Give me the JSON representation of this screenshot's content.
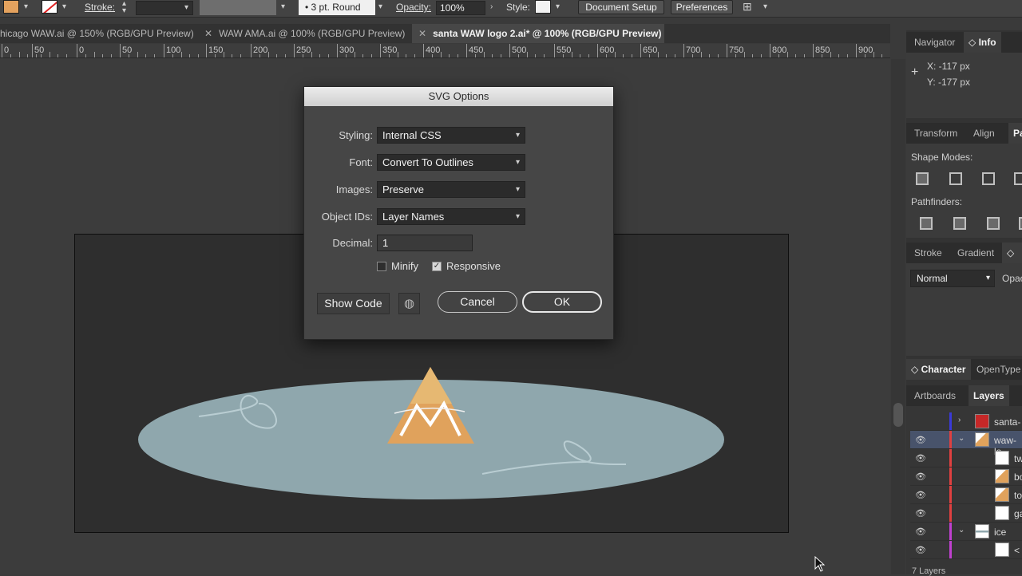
{
  "control_bar": {
    "fill_color": "#e4a25e",
    "stroke_label": "Stroke:",
    "brush_label": "3 pt. Round",
    "opacity_label": "Opacity:",
    "opacity_value": "100%",
    "style_label": "Style:",
    "document_setup": "Document Setup",
    "preferences": "Preferences"
  },
  "tabs": [
    {
      "label": "hicago WAW.ai @ 150% (RGB/GPU Preview)"
    },
    {
      "label": "WAW AMA.ai @ 100% (RGB/GPU Preview)"
    },
    {
      "label": "santa WAW logo 2.ai* @ 100% (RGB/GPU Preview)"
    }
  ],
  "ruler": [
    "0",
    "50",
    "0",
    "50",
    "100",
    "150",
    "200",
    "250",
    "300",
    "350",
    "400",
    "450",
    "500",
    "550",
    "600",
    "650",
    "700",
    "750",
    "800",
    "850",
    "900"
  ],
  "dialog": {
    "title": "SVG Options",
    "styling_label": "Styling:",
    "styling_value": "Internal CSS",
    "font_label": "Font:",
    "font_value": "Convert To Outlines",
    "images_label": "Images:",
    "images_value": "Preserve",
    "objectids_label": "Object IDs:",
    "objectids_value": "Layer Names",
    "decimal_label": "Decimal:",
    "decimal_value": "1",
    "minify_label": "Minify",
    "minify_checked": false,
    "responsive_label": "Responsive",
    "responsive_checked": true,
    "show_code": "Show Code",
    "cancel": "Cancel",
    "ok": "OK"
  },
  "panels": {
    "navigator": "Navigator",
    "info": "Info",
    "info_x": "X: -117 px",
    "info_y": "Y: -177 px",
    "transform": "Transform",
    "align": "Align",
    "pa": "Pa",
    "shape_modes": "Shape Modes:",
    "pathfinders": "Pathfinders:",
    "stroke": "Stroke",
    "gradient": "Gradient",
    "t": "T",
    "blend_mode": "Normal",
    "opacity_short": "Opac",
    "character": "Character",
    "opentype": "OpenType",
    "artboards": "Artboards",
    "layers": "Layers",
    "layer_count": "7 Layers"
  },
  "layers": [
    {
      "name": "santa-",
      "color": "#3a3ad8"
    },
    {
      "name": "waw-lo",
      "color": "#e04040"
    },
    {
      "name": "tw",
      "color": "#e04040"
    },
    {
      "name": "bo",
      "color": "#e04040"
    },
    {
      "name": "to",
      "color": "#e04040"
    },
    {
      "name": "ga",
      "color": "#e04040"
    },
    {
      "name": "ice",
      "color": "#c040d0"
    },
    {
      "name": "<",
      "color": "#c040d0"
    }
  ]
}
